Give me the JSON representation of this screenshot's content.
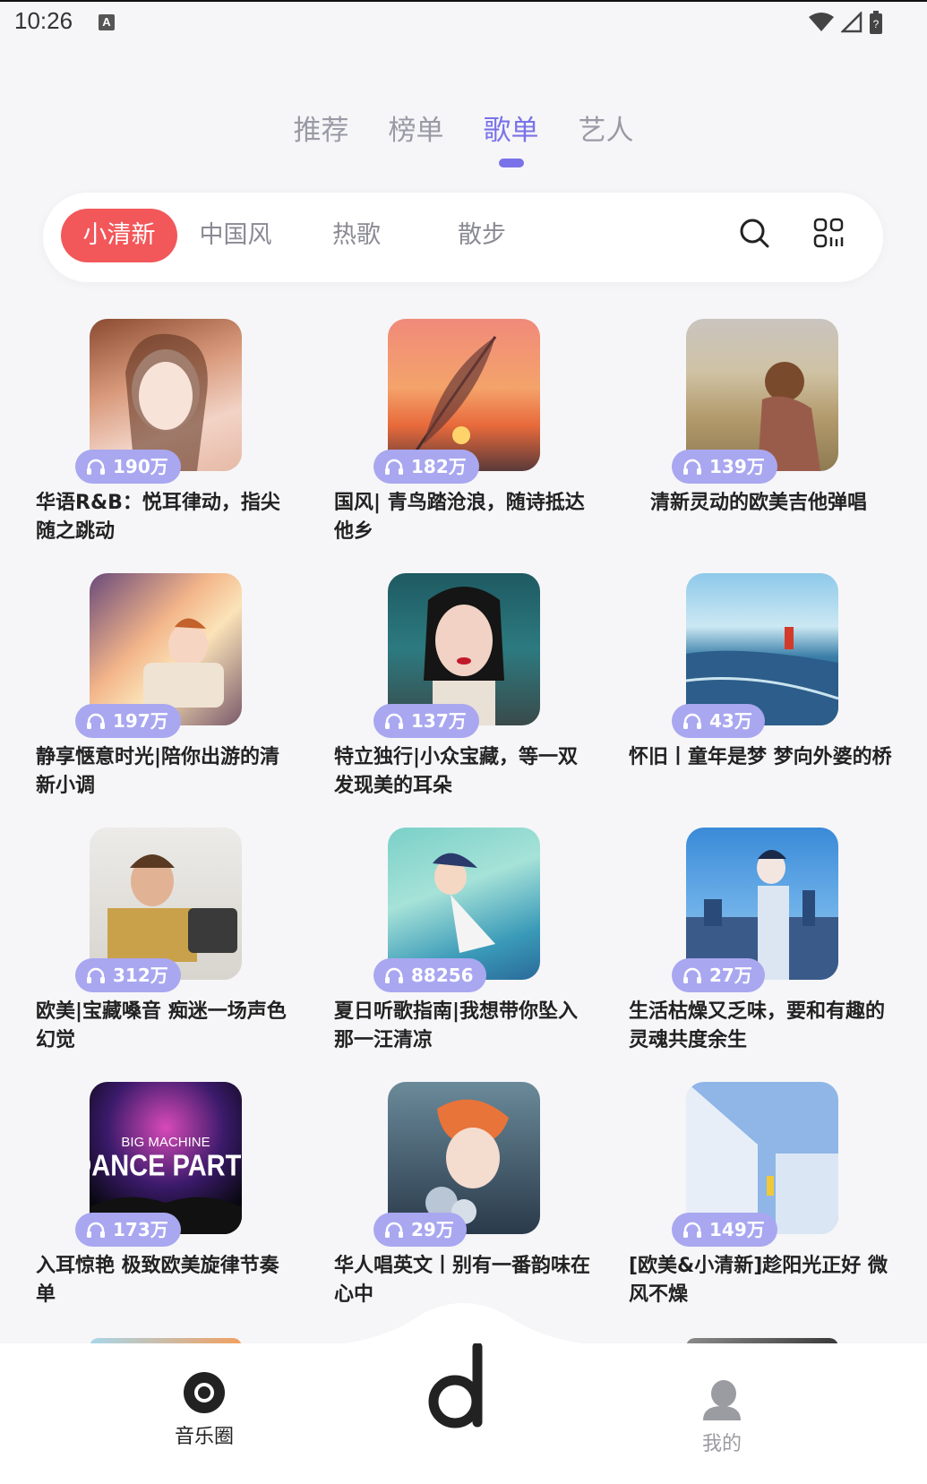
{
  "status": {
    "time": "10:26",
    "indicator": "A"
  },
  "top_tabs": [
    {
      "label": "推荐",
      "active": false
    },
    {
      "label": "榜单",
      "active": false
    },
    {
      "label": "歌单",
      "active": true
    },
    {
      "label": "艺人",
      "active": false
    }
  ],
  "filters": [
    {
      "label": "小清新",
      "active": true
    },
    {
      "label": "中国风",
      "active": false
    },
    {
      "label": "热歌",
      "active": false
    },
    {
      "label": "散步",
      "active": false
    }
  ],
  "filter_icons": {
    "search": "search-icon",
    "grid": "grid-icon"
  },
  "colors": {
    "accent": "#7a72e8",
    "active_chip": "#f2575a",
    "badge": "#a9a7f0"
  },
  "playlists": [
    {
      "title": "华语R&B：悦耳律动，指尖随之跳动",
      "plays": "190万",
      "cover": "portrait"
    },
    {
      "title": "国风| 青鸟踏沧浪，随诗抵达他乡",
      "plays": "182万",
      "cover": "feather-sunset"
    },
    {
      "title": "清新灵动的欧美吉他弹唱",
      "plays": "139万",
      "cover": "field-guitar"
    },
    {
      "title": "静享惬意时光|陪你出游的清新小调",
      "plays": "197万",
      "cover": "car-anime"
    },
    {
      "title": "特立独行|小众宝藏，等一双发现美的耳朵",
      "plays": "137万",
      "cover": "braids-portrait"
    },
    {
      "title": "怀旧丨童年是梦 梦向外婆的桥",
      "plays": "43万",
      "cover": "seaside-illustration"
    },
    {
      "title": "欧美|宝藏嗓音 痴迷一场声色幻觉",
      "plays": "312万",
      "cover": "man-radio"
    },
    {
      "title": "夏日听歌指南|我想带你坠入那一汪清凉",
      "plays": "88256",
      "cover": "underwater-anime"
    },
    {
      "title": "生活枯燥又乏味，要和有趣的灵魂共度余生",
      "plays": "27万",
      "cover": "city-anime"
    },
    {
      "title": "入耳惊艳 极致欧美旋律节奏单",
      "plays": "173万",
      "cover": "dance-party",
      "cover_text": [
        "BIG MACHINE",
        "DANCE PARTY"
      ]
    },
    {
      "title": "华人唱英文丨别有一番韵味在心中",
      "plays": "29万",
      "cover": "singer-flowers"
    },
    {
      "title": "[欧美&小清新]趁阳光正好 微风不燥",
      "plays": "149万",
      "cover": "blue-stairs"
    }
  ],
  "bottom_nav": {
    "left": {
      "label": "音乐圈",
      "icon": "circle-music-icon"
    },
    "center": {
      "icon": "music-note-logo-icon"
    },
    "right": {
      "label": "我的",
      "icon": "user-icon"
    }
  }
}
